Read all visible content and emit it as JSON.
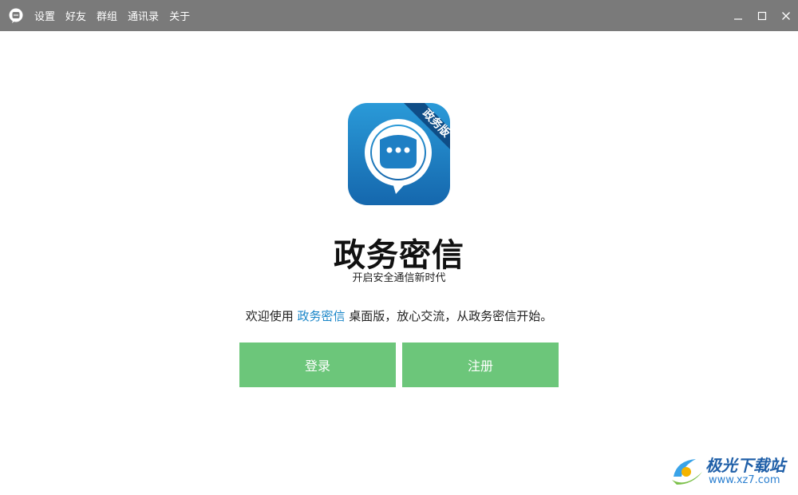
{
  "titlebar": {
    "menu": [
      "设置",
      "好友",
      "群组",
      "通讯录",
      "关于"
    ]
  },
  "logo": {
    "ribbon_text": "政务版"
  },
  "main": {
    "app_name": "政务密信",
    "slogan": "开启安全通信新时代",
    "welcome_prefix": "欢迎使用 ",
    "welcome_link": "政务密信",
    "welcome_suffix": " 桌面版，放心交流，从政务密信开始。",
    "login_label": "登录",
    "register_label": "注册"
  },
  "watermark": {
    "title": "极光下载站",
    "url": "www.xz7.com"
  },
  "colors": {
    "titlebar": "#7a7a7a",
    "button": "#6cc67a",
    "link": "#1a86c8",
    "logo_blue": "#1e7fc4"
  }
}
